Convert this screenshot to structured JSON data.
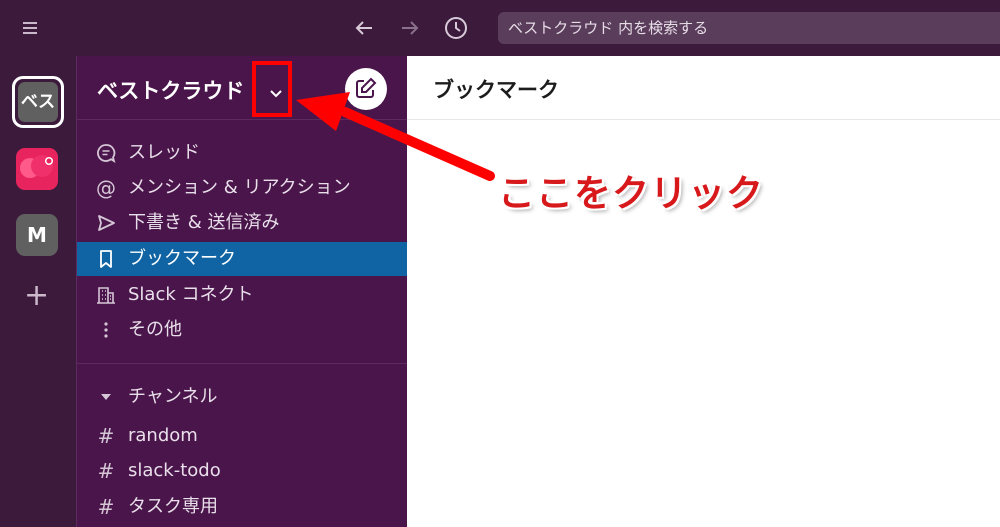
{
  "search": {
    "placeholder": "ベストクラウド 内を検索する"
  },
  "rail": {
    "workspaces": [
      {
        "label": "ベス"
      },
      {
        "label": ""
      },
      {
        "label": "M"
      }
    ]
  },
  "sidebar": {
    "workspace_name": "ベストクラウド",
    "nav": [
      {
        "label": "スレッド",
        "icon": "threads-icon"
      },
      {
        "label": "メンション & リアクション",
        "icon": "mention-icon"
      },
      {
        "label": "下書き & 送信済み",
        "icon": "send-icon"
      },
      {
        "label": "ブックマーク",
        "icon": "bookmark-icon",
        "active": true
      },
      {
        "label": "Slack コネクト",
        "icon": "building-icon"
      },
      {
        "label": "その他",
        "icon": "more-vertical-icon"
      }
    ],
    "channels_header": "チャンネル",
    "channels": [
      {
        "label": "random"
      },
      {
        "label": "slack-todo"
      },
      {
        "label": "タスク専用"
      }
    ]
  },
  "main": {
    "title": "ブックマーク"
  },
  "annotation": {
    "text": "ここをクリック",
    "color": "#d7191c"
  },
  "colors": {
    "aubergine": "#4a154b",
    "topbar": "#3b1a3c",
    "active": "#1164a3"
  }
}
